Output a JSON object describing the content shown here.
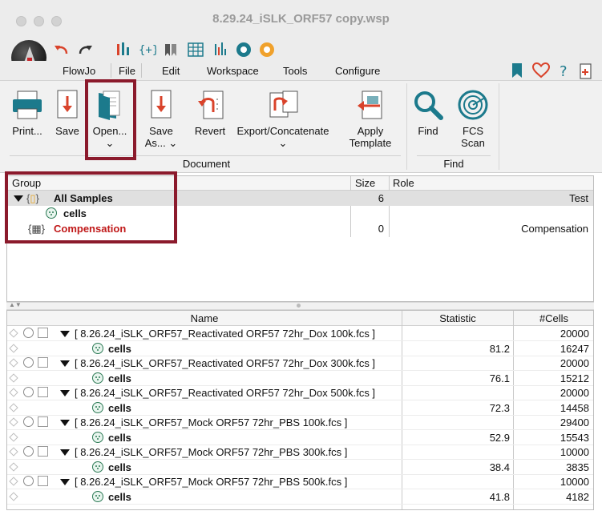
{
  "window": {
    "title": "8.29.24_iSLK_ORF57 copy.wsp"
  },
  "menu": {
    "items": [
      "FlowJo",
      "File",
      "Edit",
      "Workspace",
      "Tools",
      "Configure"
    ],
    "active": "File"
  },
  "ribbon": {
    "buttons": {
      "print": "Print...",
      "save": "Save",
      "open": "Open...",
      "save_as_line1": "Save",
      "save_as_line2": "As...",
      "revert": "Revert",
      "export": "Export/Concatenate",
      "apply_line1": "Apply",
      "apply_line2": "Template",
      "find": "Find",
      "fcs_line1": "FCS",
      "fcs_line2": "Scan"
    },
    "groups": {
      "document": "Document",
      "find": "Find"
    }
  },
  "group_table": {
    "headers": {
      "group": "Group",
      "size": "Size",
      "role": "Role"
    },
    "rows": [
      {
        "name": "All Samples",
        "size": "6",
        "role": "Test"
      },
      {
        "name": "cells",
        "size": "",
        "role": ""
      },
      {
        "name": "Compensation",
        "size": "0",
        "role": "Compensation"
      }
    ]
  },
  "sample_table": {
    "headers": {
      "name": "Name",
      "statistic": "Statistic",
      "cells": "#Cells"
    },
    "rows": [
      {
        "name": "[ 8.26.24_iSLK_ORF57_Reactivated ORF57 72hr_Dox 100k.fcs ]",
        "statistic": "",
        "cells": "20000"
      },
      {
        "name": "cells",
        "statistic": "81.2",
        "cells": "16247"
      },
      {
        "name": "[ 8.26.24_iSLK_ORF57_Reactivated ORF57 72hr_Dox 300k.fcs ]",
        "statistic": "",
        "cells": "20000"
      },
      {
        "name": "cells",
        "statistic": "76.1",
        "cells": "15212"
      },
      {
        "name": "[ 8.26.24_iSLK_ORF57_Reactivated ORF57 72hr_Dox 500k.fcs ]",
        "statistic": "",
        "cells": "20000"
      },
      {
        "name": "cells",
        "statistic": "72.3",
        "cells": "14458"
      },
      {
        "name": "[ 8.26.24_iSLK_ORF57_Mock ORF57 72hr_PBS 100k.fcs ]",
        "statistic": "",
        "cells": "29400"
      },
      {
        "name": "cells",
        "statistic": "52.9",
        "cells": "15543"
      },
      {
        "name": "[ 8.26.24_iSLK_ORF57_Mock ORF57 72hr_PBS 300k.fcs ]",
        "statistic": "",
        "cells": "10000"
      },
      {
        "name": "cells",
        "statistic": "38.4",
        "cells": "3835"
      },
      {
        "name": "[ 8.26.24_iSLK_ORF57_Mock ORF57 72hr_PBS 500k.fcs ]",
        "statistic": "",
        "cells": "10000"
      },
      {
        "name": "cells",
        "statistic": "41.8",
        "cells": "4182"
      }
    ]
  },
  "colors": {
    "highlight_box": "#8b1a2c",
    "compensation_text": "#c01818",
    "accent_teal": "#1c7a8c",
    "accent_red": "#d9432b"
  }
}
